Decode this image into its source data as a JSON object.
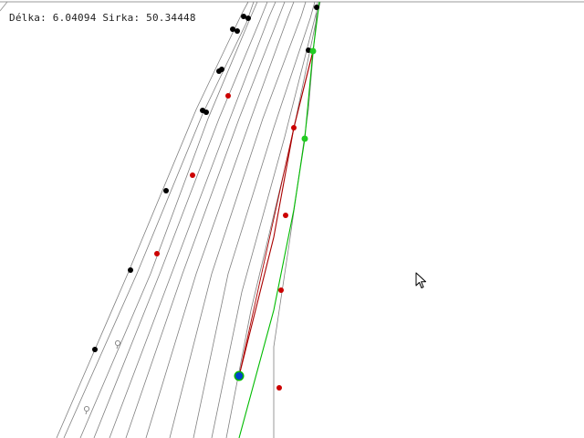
{
  "status": {
    "longitude_label": "Délka:",
    "longitude_value": "6.04094",
    "latitude_label": "Sirka:",
    "latitude_value": "50.34448"
  },
  "map": {
    "background_color": "#ffffff",
    "colors": {
      "contour_line": "#808080",
      "black_point": "#000000",
      "red_point": "#cc0000",
      "green_point": "#22cc22",
      "route_red": "#aa0000",
      "route_green": "#00bb00",
      "current_position": "#0044cc",
      "top_edge": "#9a9a9a"
    },
    "icons": {
      "current_position": "blue-position-dot-icon",
      "waypoint_marker": "grey-pin-icon",
      "cursor": "arrow-cursor-icon"
    }
  }
}
